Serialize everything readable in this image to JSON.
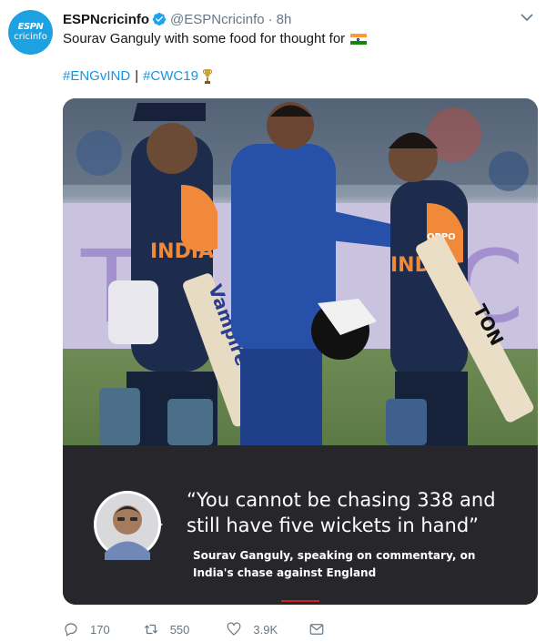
{
  "tweet": {
    "avatar_line1": "ESPN",
    "avatar_line2": "cricinfo",
    "author_name": "ESPNcricinfo",
    "author_handle": "@ESPNcricinfo",
    "separator": "·",
    "timestamp": "8h",
    "text": "Sourav Ganguly with some food for thought for",
    "flag_icon": "india-flag-emoji",
    "hashtags": [
      "#ENGvIND",
      "#CWC19"
    ],
    "hashtag_separator": "|",
    "trophy_icon": "cwc-trophy-emoji"
  },
  "card": {
    "photo_icon": "cricket-players-photo",
    "jersey_text": "INDIA",
    "sponsor_text": "OPPO",
    "bat_text": "Vampire",
    "bat2_text": "TON",
    "quote": "“You cannot be chasing 338 and still have five wickets in hand”",
    "attribution": "Sourav Ganguly, speaking on commentary, on India's chase against England"
  },
  "actions": {
    "reply_count": "170",
    "retweet_count": "550",
    "like_count": "3.9K"
  },
  "colors": {
    "brand_blue": "#1da1f2",
    "link_blue": "#1b95e0",
    "muted": "#657786",
    "card_dark": "#27262b",
    "accent_red": "#d01f27"
  }
}
